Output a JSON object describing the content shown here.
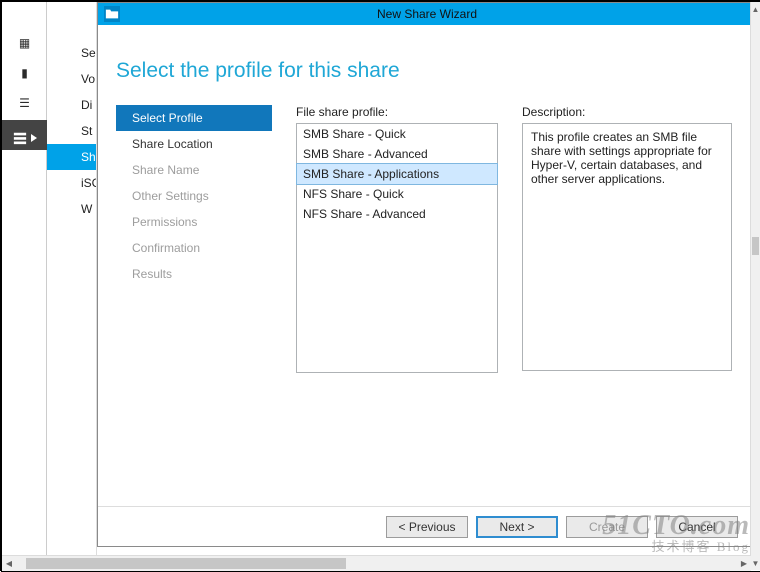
{
  "iconstrip": {
    "icons": [
      {
        "name": "dashboard-icon",
        "glyph": "▦"
      },
      {
        "name": "server-icon",
        "glyph": "▮"
      },
      {
        "name": "all-servers-icon",
        "glyph": "☰"
      },
      {
        "name": "file-services-icon",
        "glyph": "▤",
        "selected": true
      }
    ]
  },
  "partialnav": {
    "items": [
      {
        "label": "Se"
      },
      {
        "label": "Vo"
      },
      {
        "label": "Di"
      },
      {
        "label": "St"
      },
      {
        "label": "Sh",
        "selected": true
      },
      {
        "label": "iSC"
      },
      {
        "label": "W"
      }
    ]
  },
  "wizard": {
    "title": "New Share Wizard",
    "heading": "Select the profile for this share",
    "steps": [
      {
        "label": "Select Profile",
        "state": "active"
      },
      {
        "label": "Share Location",
        "state": "enabled"
      },
      {
        "label": "Share Name",
        "state": "disabled"
      },
      {
        "label": "Other Settings",
        "state": "disabled"
      },
      {
        "label": "Permissions",
        "state": "disabled"
      },
      {
        "label": "Confirmation",
        "state": "disabled"
      },
      {
        "label": "Results",
        "state": "disabled"
      }
    ],
    "profile_label": "File share profile:",
    "profiles": [
      {
        "label": "SMB Share - Quick"
      },
      {
        "label": "SMB Share - Advanced"
      },
      {
        "label": "SMB Share - Applications",
        "selected": true
      },
      {
        "label": "NFS Share - Quick"
      },
      {
        "label": "NFS Share - Advanced"
      }
    ],
    "description_label": "Description:",
    "description_text": "This profile creates an SMB file share with settings appropriate for Hyper-V, certain databases, and other server applications.",
    "buttons": {
      "previous": "< Previous",
      "next": "Next >",
      "create": "Create",
      "cancel": "Cancel"
    }
  },
  "watermark": {
    "line1": "51CTO.com",
    "line2": "技术博客  Blog"
  }
}
